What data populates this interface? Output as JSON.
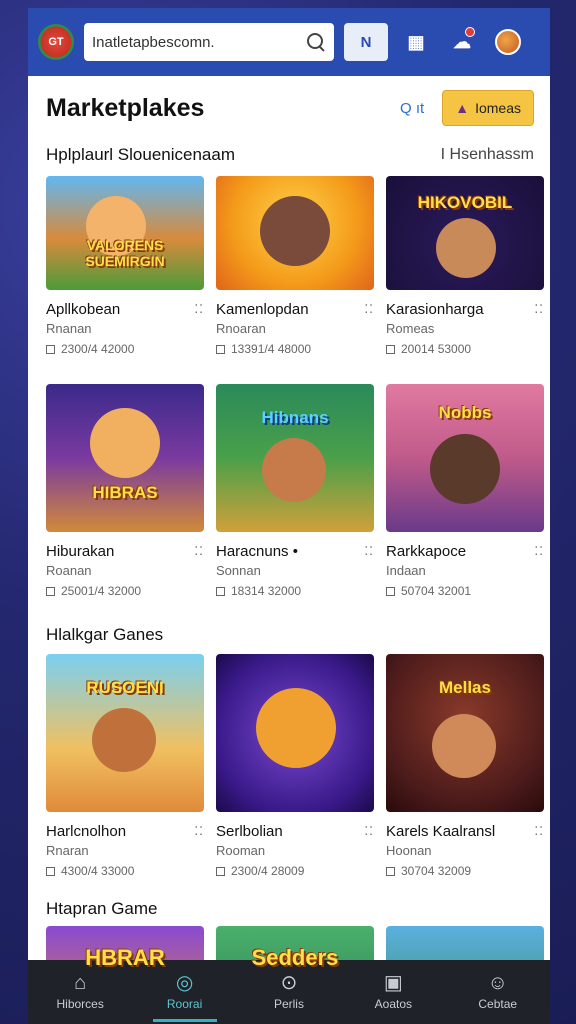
{
  "topbar": {
    "logo_text": "GT",
    "search_value": "Inatletapbescomn.",
    "nav_badge_label": "N",
    "icons": [
      "grid-icon",
      "notification-icon",
      "avatar-icon"
    ]
  },
  "header": {
    "title": "Marketplakes",
    "link_label": "Q ıt",
    "button_label": "Iomeas"
  },
  "sections": [
    {
      "title": "Hplplaurl Slouenicenaam",
      "link": "I Hsenhassm",
      "cards": [
        {
          "title": "Apllkobean",
          "sub": "Rnanan",
          "meta": "2300/4 42000",
          "art": "VALORENS SUEMIRGIN"
        },
        {
          "title": "Kamenlopdan",
          "sub": "Rnoaran",
          "meta": "13391/4 48000",
          "art": ""
        },
        {
          "title": "Karasionharga",
          "sub": "Romeas",
          "meta": "20014 53000",
          "art": "HIKOVOBIL"
        }
      ]
    },
    {
      "title": "",
      "link": "",
      "cards": [
        {
          "title": "Hiburakan",
          "sub": "Roanan",
          "meta": "25001/4 32000",
          "art": "HIBRAS"
        },
        {
          "title": "Haracnuns •",
          "sub": "Sonnan",
          "meta": "18314 32000",
          "art": "Hibnans"
        },
        {
          "title": "Rarkkapoce",
          "sub": "Indaan",
          "meta": "50704 32001",
          "art": "Nobbs"
        }
      ]
    },
    {
      "title": "Hlalkgar Ganes",
      "link": "",
      "cards": [
        {
          "title": "Harlcnolhon",
          "sub": "Rnaran",
          "meta": "4300/4 33000",
          "art": "RUSOENI"
        },
        {
          "title": "Serlbolian",
          "sub": "Rooman",
          "meta": "2300/4 28009",
          "art": ""
        },
        {
          "title": "Karels Kaalransl",
          "sub": "Hoonan",
          "meta": "30704 32009",
          "art": "Mellas"
        }
      ]
    },
    {
      "title": "Htapran Game",
      "link": "",
      "cards": [
        {
          "title": "",
          "sub": "",
          "meta": "",
          "art": "HBRAR"
        },
        {
          "title": "",
          "sub": "",
          "meta": "",
          "art": "Sedders"
        },
        {
          "title": "",
          "sub": "",
          "meta": "",
          "art": ""
        }
      ]
    }
  ],
  "bottom_nav": [
    {
      "label": "Hiborces",
      "icon": "home-icon"
    },
    {
      "label": "Roorai",
      "icon": "compass-icon"
    },
    {
      "label": "Perlis",
      "icon": "location-icon"
    },
    {
      "label": "Aoatos",
      "icon": "archive-icon"
    },
    {
      "label": "Cebtae",
      "icon": "profile-icon"
    }
  ],
  "colors": {
    "topbar": "#2a4bb0",
    "accent_button": "#f6c443",
    "nav_active": "#5cc4d2",
    "bottom_nav_bg": "#1f2228"
  }
}
